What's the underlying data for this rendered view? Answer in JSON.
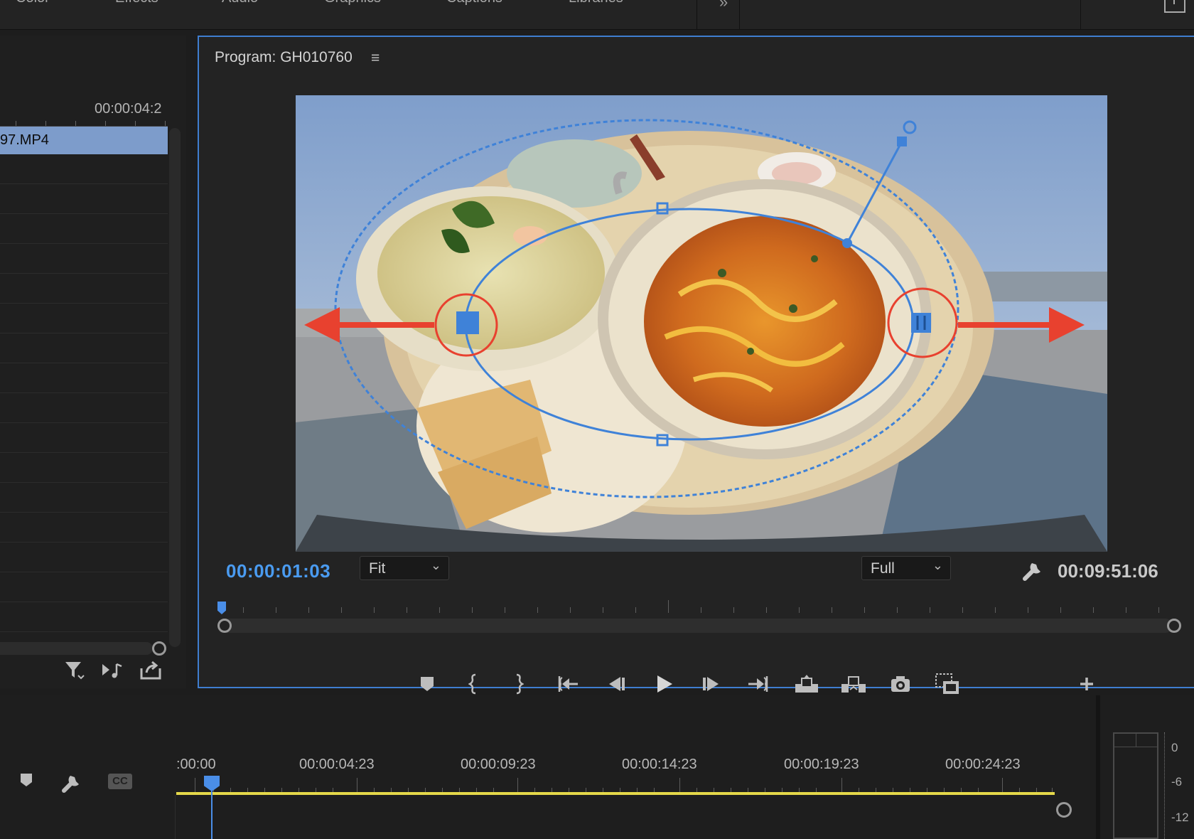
{
  "workspace_tabs": [
    "Color",
    "Effects",
    "Audio",
    "Graphics",
    "Captions",
    "Libraries"
  ],
  "workspace_overflow": "»",
  "project_panel": {
    "ruler_time": "00:00:04:2",
    "clip_name": "97.MP4",
    "tools": [
      "filter-icon",
      "insert-audio-icon",
      "export-icon"
    ]
  },
  "program": {
    "title": "Program: GH010760",
    "menu_icon": "≡",
    "current_time": "00:00:01:03",
    "zoom": {
      "selected": "Fit"
    },
    "resolution": {
      "selected": "Full"
    },
    "duration": "00:09:51:06",
    "transport": [
      "add-marker-icon",
      "mark-in-icon",
      "mark-out-icon",
      "go-to-in-icon",
      "step-back-icon",
      "play-icon",
      "step-forward-icon",
      "go-to-out-icon",
      "lift-icon",
      "extract-icon",
      "export-frame-icon",
      "comparison-view-icon",
      "add-button-icon"
    ]
  },
  "timeline": {
    "times": [
      ":00:00",
      "00:00:04:23",
      "00:00:09:23",
      "00:00:14:23",
      "00:00:19:23",
      "00:00:24:23"
    ],
    "tools": [
      "marker-icon",
      "wrench-icon",
      "captions-icon"
    ],
    "captions_label": "CC"
  },
  "meter": {
    "labels": [
      "0",
      "-6",
      "-12"
    ]
  },
  "colors": {
    "accent": "#4a9bf0",
    "panel_border": "#3f7ed0",
    "annotation": "#e8412f",
    "work_area": "#e5d84a"
  }
}
